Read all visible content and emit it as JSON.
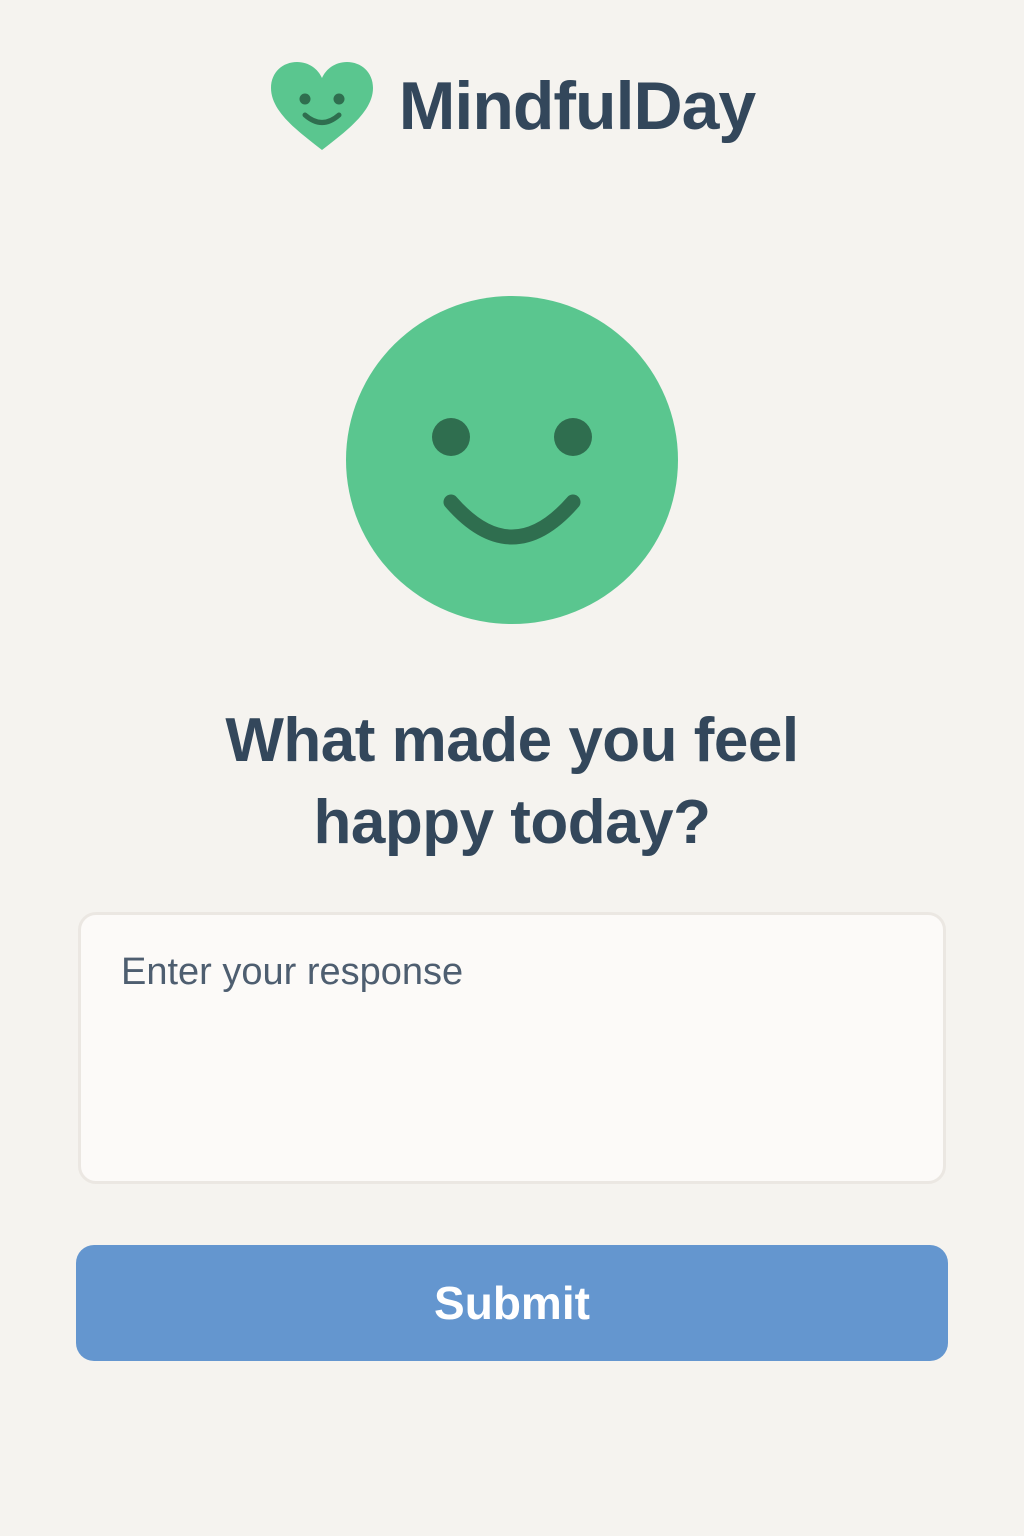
{
  "app": {
    "name": "MindfulDay",
    "logo_icon": "heart-smile-icon"
  },
  "mood": {
    "icon": "smiley-face-icon",
    "state": "happy"
  },
  "prompt": {
    "question": "What made you feel\nhappy today?"
  },
  "response": {
    "placeholder": "Enter your response",
    "value": ""
  },
  "actions": {
    "submit_label": "Submit"
  },
  "colors": {
    "background": "#f5f3ef",
    "accent_green": "#5ac68f",
    "face_features": "#2f6e4f",
    "text_dark": "#33475b",
    "button_blue": "#6496cf"
  }
}
